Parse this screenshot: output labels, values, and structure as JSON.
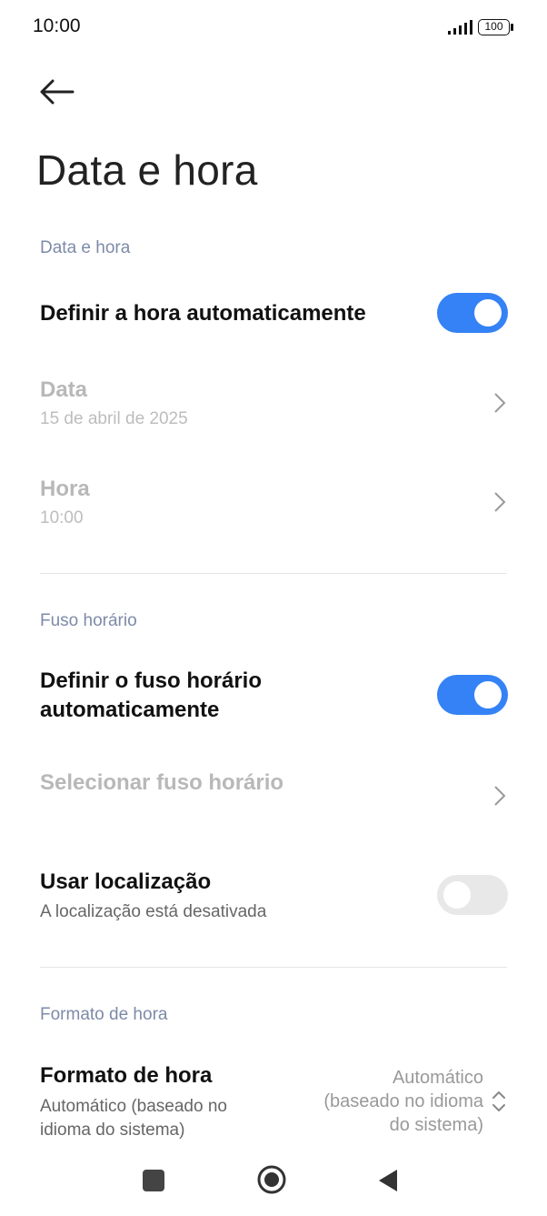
{
  "status_bar": {
    "time": "10:00",
    "battery": "100"
  },
  "page_title": "Data e hora",
  "sections": {
    "datetime": {
      "header": "Data e hora",
      "auto_time": {
        "title": "Definir a hora automaticamente",
        "enabled": true
      },
      "date": {
        "title": "Data",
        "value": "15 de abril de 2025"
      },
      "time": {
        "title": "Hora",
        "value": "10:00"
      }
    },
    "timezone": {
      "header": "Fuso horário",
      "auto_tz": {
        "title_line1": "Definir o fuso horário",
        "title_line2": "automaticamente",
        "enabled": true
      },
      "select_tz": {
        "title": "Selecionar fuso horário"
      },
      "use_location": {
        "title": "Usar localização",
        "subtitle": "A localização está desativada",
        "enabled": false
      }
    },
    "time_format": {
      "header": "Formato de hora",
      "format": {
        "title": "Formato de hora",
        "subtitle_line1": "Automático (baseado no",
        "subtitle_line2": "idioma do sistema)",
        "value_line1": "Automático",
        "value_line2": "(baseado no idioma",
        "value_line3": "do sistema)"
      }
    }
  },
  "icons": {
    "signal": "signal-icon",
    "battery": "battery-icon",
    "back": "back-arrow-icon",
    "chevron": "chevron-right-icon",
    "updown": "chevron-updown-icon",
    "nav_recents": "square-icon",
    "nav_home": "circle-icon",
    "nav_back": "triangle-icon"
  }
}
